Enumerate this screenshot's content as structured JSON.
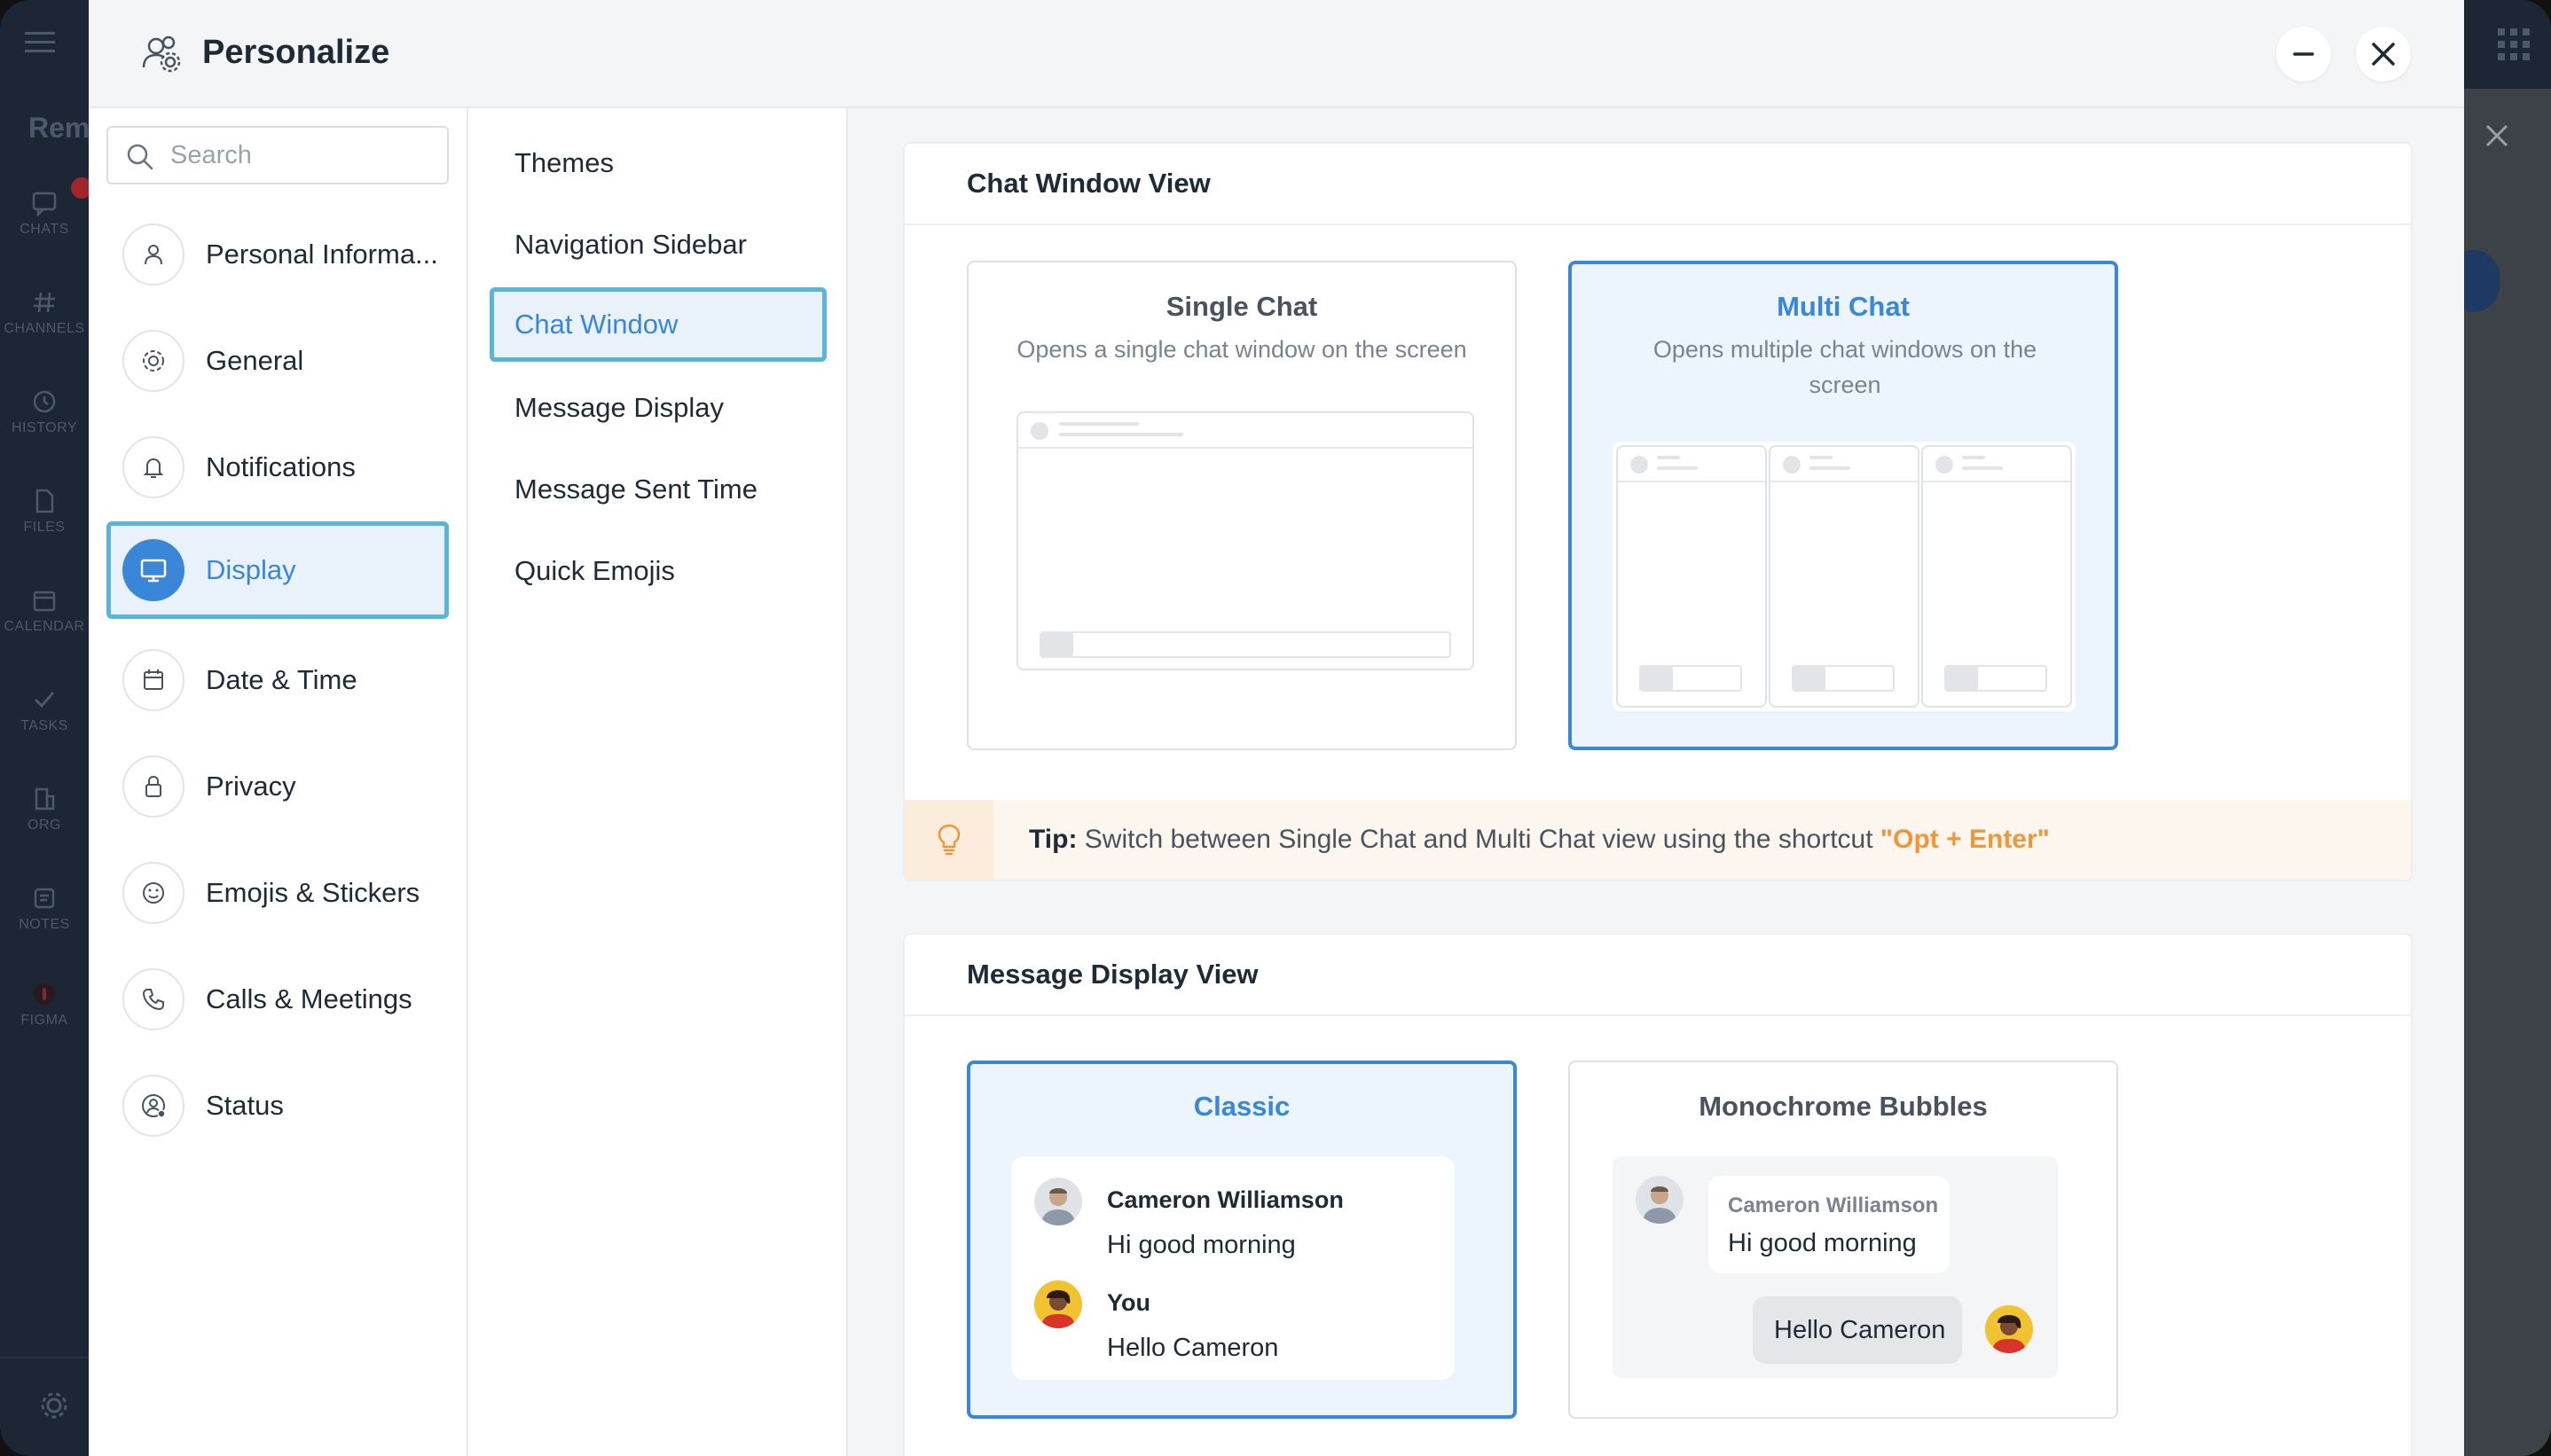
{
  "background_app": {
    "sidebar": [
      {
        "label": "CHATS",
        "icon": "chat-icon"
      },
      {
        "label": "CHANNELS",
        "icon": "hash-icon"
      },
      {
        "label": "HISTORY",
        "icon": "history-icon"
      },
      {
        "label": "FILES",
        "icon": "file-icon"
      },
      {
        "label": "CALENDAR",
        "icon": "calendar-icon"
      },
      {
        "label": "TASKS",
        "icon": "check-icon"
      },
      {
        "label": "ORG",
        "icon": "org-icon"
      },
      {
        "label": "NOTES",
        "icon": "notes-icon"
      },
      {
        "label": "FIGMA",
        "icon": "figma-icon"
      }
    ],
    "partial_title": "Rem"
  },
  "modal": {
    "title": "Personalize",
    "title_icon": "people-settings-icon",
    "minimize_icon": "minus-icon",
    "close_icon": "close-icon"
  },
  "search": {
    "placeholder": "Search"
  },
  "left_nav": {
    "items": [
      {
        "label": "Personal Informa...",
        "icon": "user-icon"
      },
      {
        "label": "General",
        "icon": "gear-icon"
      },
      {
        "label": "Notifications",
        "icon": "bell-icon"
      },
      {
        "label": "Display",
        "icon": "monitor-icon"
      },
      {
        "label": "Date & Time",
        "icon": "calendar-icon"
      },
      {
        "label": "Privacy",
        "icon": "lock-icon"
      },
      {
        "label": "Emojis & Stickers",
        "icon": "smiley-icon"
      },
      {
        "label": "Calls & Meetings",
        "icon": "phone-icon"
      },
      {
        "label": "Status",
        "icon": "user-status-icon"
      }
    ],
    "active": "Display"
  },
  "sub_nav": {
    "items": [
      "Themes",
      "Navigation Sidebar",
      "Chat Window",
      "Message Display",
      "Message Sent Time",
      "Quick Emojis"
    ],
    "active": "Chat Window"
  },
  "chat_window_view": {
    "title": "Chat Window View",
    "options": [
      {
        "title": "Single Chat",
        "desc": "Opens a single chat window on the screen",
        "selected": false
      },
      {
        "title": "Multi Chat",
        "desc": "Opens multiple chat windows on the screen",
        "selected": true
      }
    ],
    "tip": {
      "label": "Tip:",
      "text": " Switch between Single Chat and Multi Chat view using the shortcut ",
      "shortcut": "\"Opt + Enter\"",
      "icon": "lightbulb-icon"
    }
  },
  "message_display_view": {
    "title": "Message Display View",
    "options": [
      {
        "title": "Classic",
        "selected": true,
        "messages": [
          {
            "name": "Cameron Williamson",
            "text": "Hi good morning"
          },
          {
            "name": "You",
            "text": "Hello Cameron"
          }
        ]
      },
      {
        "title": "Monochrome Bubbles",
        "selected": false,
        "messages": [
          {
            "name": "Cameron Williamson",
            "text": "Hi good morning"
          },
          {
            "name": "",
            "text": "Hello Cameron"
          }
        ]
      }
    ]
  },
  "colors": {
    "accent": "#3a86d8",
    "selected_outline": "#5bb5d9",
    "tip_highlight": "#f0963a"
  }
}
